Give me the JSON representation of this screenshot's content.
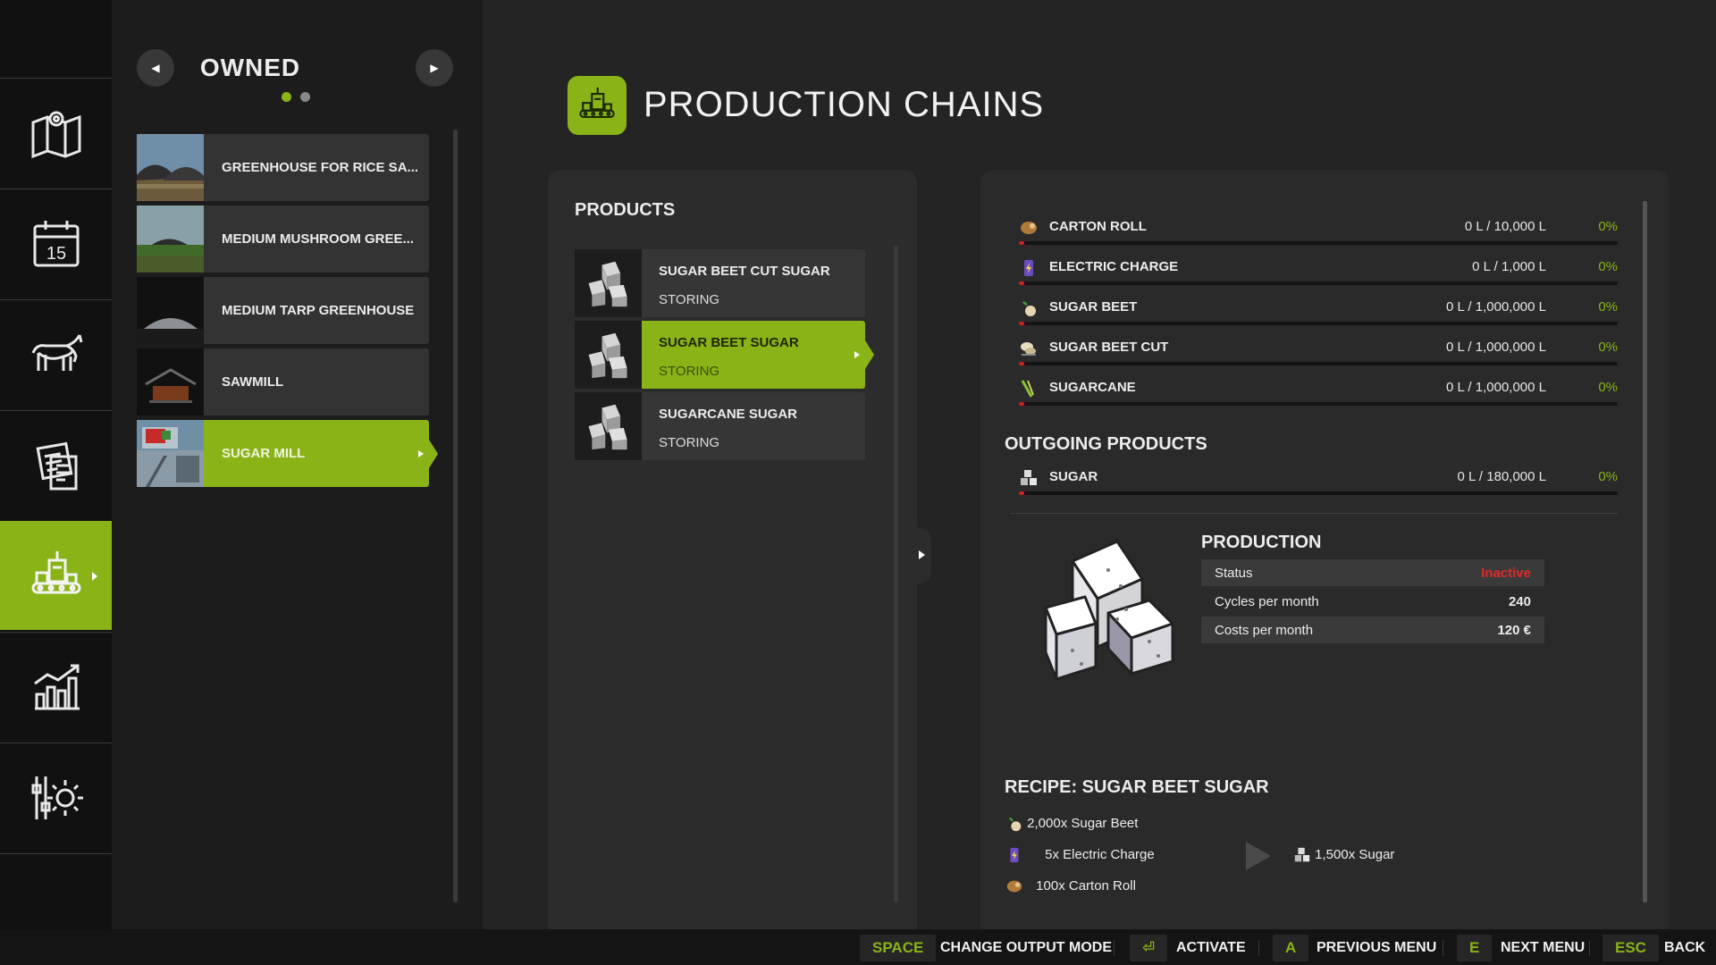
{
  "nav": {
    "items": [
      {
        "icon": "map-icon"
      },
      {
        "icon": "calendar-icon",
        "day": "15"
      },
      {
        "icon": "animals-icon"
      },
      {
        "icon": "contracts-icon"
      },
      {
        "icon": "production-icon"
      },
      {
        "icon": "statistics-icon"
      },
      {
        "icon": "settings-icon"
      }
    ]
  },
  "owned": {
    "title": "OWNED",
    "items": [
      {
        "label": "GREENHOUSE FOR RICE SA..."
      },
      {
        "label": "MEDIUM MUSHROOM GREE..."
      },
      {
        "label": "MEDIUM TARP GREENHOUSE"
      },
      {
        "label": "SAWMILL"
      },
      {
        "label": "SUGAR MILL"
      }
    ]
  },
  "header": {
    "title": "PRODUCTION CHAINS"
  },
  "products": {
    "title": "PRODUCTS",
    "items": [
      {
        "name": "SUGAR BEET CUT SUGAR",
        "status": "STORING"
      },
      {
        "name": "SUGAR BEET SUGAR",
        "status": "STORING"
      },
      {
        "name": "SUGARCANE SUGAR",
        "status": "STORING"
      }
    ]
  },
  "incoming": [
    {
      "name": "CARTON ROLL",
      "amount": "0 L / 10,000 L",
      "percent": "0%",
      "icon": "carton-roll-icon"
    },
    {
      "name": "ELECTRIC CHARGE",
      "amount": "0 L / 1,000 L",
      "percent": "0%",
      "icon": "electric-charge-icon"
    },
    {
      "name": "SUGAR BEET",
      "amount": "0 L / 1,000,000 L",
      "percent": "0%",
      "icon": "sugar-beet-icon"
    },
    {
      "name": "SUGAR BEET CUT",
      "amount": "0 L / 1,000,000 L",
      "percent": "0%",
      "icon": "sugar-beet-cut-icon"
    },
    {
      "name": "SUGARCANE",
      "amount": "0 L / 1,000,000 L",
      "percent": "0%",
      "icon": "sugarcane-icon"
    }
  ],
  "outgoing": {
    "title": "OUTGOING PRODUCTS",
    "items": [
      {
        "name": "SUGAR",
        "amount": "0 L / 180,000 L",
        "percent": "0%",
        "icon": "sugar-icon"
      }
    ]
  },
  "production": {
    "title": "PRODUCTION",
    "status_label": "Status",
    "status_value": "Inactive",
    "cycles_label": "Cycles per month",
    "cycles_value": "240",
    "costs_label": "Costs per month",
    "costs_value": "120 €"
  },
  "recipe": {
    "title": "RECIPE: SUGAR BEET SUGAR",
    "inputs": [
      "2,000x Sugar Beet",
      "5x Electric Charge",
      "100x Carton Roll"
    ],
    "output": "1,500x Sugar"
  },
  "bottom": [
    {
      "key": "SPACE",
      "label": "CHANGE OUTPUT MODE"
    },
    {
      "key": "⏎",
      "label": "ACTIVATE"
    },
    {
      "key": "A",
      "label": "PREVIOUS MENU"
    },
    {
      "key": "E",
      "label": "NEXT MENU"
    },
    {
      "key": "ESC",
      "label": "BACK"
    }
  ],
  "colors": {
    "accent": "#8ab317",
    "inactive": "#e02a2a",
    "bar_fill": "#d12020"
  }
}
